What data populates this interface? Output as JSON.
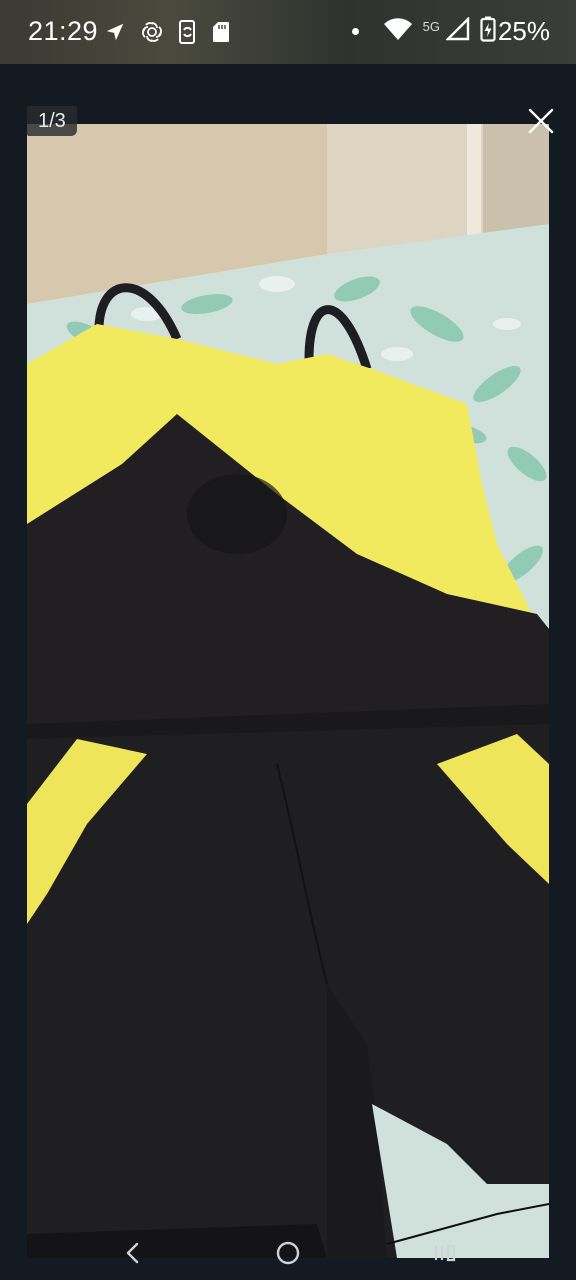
{
  "status_bar": {
    "time": "21:29",
    "network": "5G",
    "battery": "25%",
    "left_icons": [
      "navigation-icon",
      "openai-icon",
      "phone-sync-icon",
      "sd-card-icon"
    ],
    "right_icons": [
      "notification-dot-icon",
      "wifi-icon",
      "signal-icon",
      "battery-charging-icon"
    ]
  },
  "viewer": {
    "page_counter": "1/3",
    "close_icon": "close-icon",
    "image_subject": "photo"
  },
  "nav_bar": {
    "back_icon": "back-icon",
    "home_icon": "home-icon",
    "recents_icon": "recents-icon"
  },
  "colors": {
    "background": "#131a22",
    "garment_black": "#1f1d1f",
    "garment_yellow": "#f2ea5c",
    "bedsheet": "#cfe2dc",
    "leaf_green": "#72bfa3",
    "wall": "#d6c7ad"
  }
}
